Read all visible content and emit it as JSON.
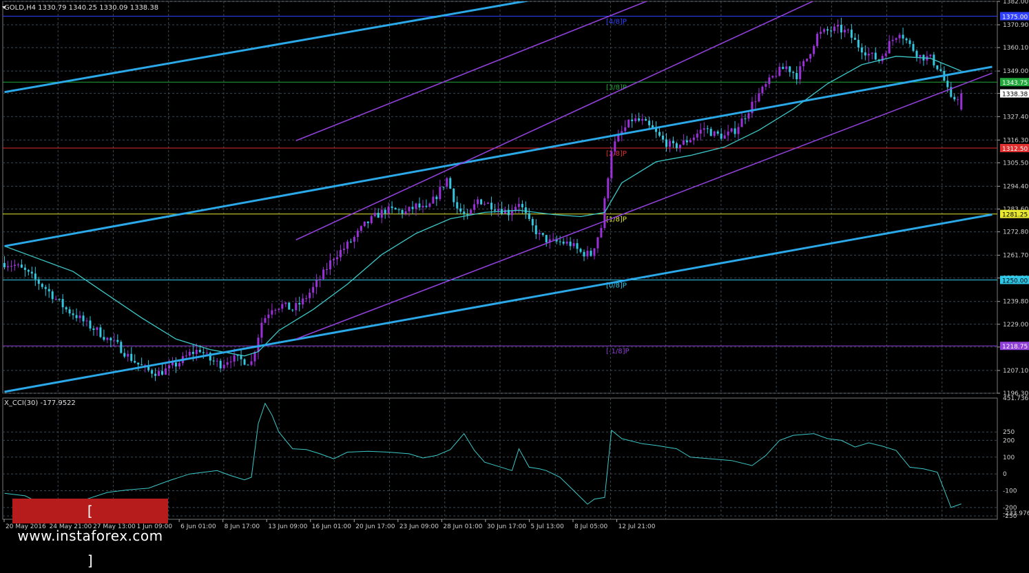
{
  "header": {
    "main_title": "GOLD,H4  1330.79 1340.25 1330.09 1338.38",
    "sub_title": "X_CCI(30) -177.9522"
  },
  "colors": {
    "background": "#000000",
    "grid": "#3a4a56",
    "candle_bull": "#9b30d9",
    "candle_bear": "#33c7e0",
    "moving_average": "#3cc8c8",
    "channel_blue": "#2aa8e8",
    "channel_purple": "#9040d8",
    "cci_line": "#3cc8c8",
    "axis_text": "#cfcfcf"
  },
  "watermark": {
    "text": "[ www.instaforex.com ]"
  },
  "chart_data": [
    {
      "type": "candlestick",
      "symbol": "GOLD",
      "timeframe": "H4",
      "ohlc_last": {
        "open": 1330.79,
        "high": 1340.25,
        "low": 1330.09,
        "close": 1338.38
      },
      "x_tick_labels": [
        "20 May 2016",
        "24 May 21:00",
        "27 May 13:00",
        "1 Jun 09:00",
        "6 Jun 01:00",
        "8 Jun 17:00",
        "13 Jun 09:00",
        "16 Jun 01:00",
        "20 Jun 17:00",
        "23 Jun 09:00",
        "28 Jun 01:00",
        "30 Jun 17:00",
        "5 Jul 13:00",
        "8 Jul 05:00",
        "12 Jul 21:00"
      ],
      "y_ticks": [
        1382.0,
        1370.9,
        1360.1,
        1349.0,
        1338.38,
        1327.4,
        1316.3,
        1305.5,
        1294.4,
        1283.6,
        1272.8,
        1261.7,
        1250.9,
        1239.8,
        1229.0,
        1218.2,
        1207.1,
        1196.3
      ],
      "ylim": [
        1196.3,
        1382.0
      ],
      "close_path": [
        [
          0,
          1258
        ],
        [
          3,
          1257
        ],
        [
          6,
          1254
        ],
        [
          9,
          1250
        ],
        [
          12,
          1246
        ],
        [
          15,
          1241
        ],
        [
          18,
          1236
        ],
        [
          21,
          1233
        ],
        [
          24,
          1229
        ],
        [
          27,
          1226
        ],
        [
          30,
          1222
        ],
        [
          33,
          1219
        ],
        [
          36,
          1214
        ],
        [
          39,
          1210
        ],
        [
          42,
          1207
        ],
        [
          45,
          1206
        ],
        [
          48,
          1208
        ],
        [
          51,
          1211
        ],
        [
          54,
          1215
        ],
        [
          57,
          1217
        ],
        [
          60,
          1212
        ],
        [
          63,
          1210
        ],
        [
          66,
          1213
        ],
        [
          69,
          1212
        ],
        [
          72,
          1211
        ],
        [
          75,
          1230
        ],
        [
          78,
          1237
        ],
        [
          81,
          1238
        ],
        [
          84,
          1236
        ],
        [
          87,
          1240
        ],
        [
          90,
          1246
        ],
        [
          93,
          1253
        ],
        [
          96,
          1261
        ],
        [
          99,
          1265
        ],
        [
          102,
          1270
        ],
        [
          105,
          1276
        ],
        [
          108,
          1280
        ],
        [
          111,
          1283
        ],
        [
          114,
          1283
        ],
        [
          117,
          1282
        ],
        [
          120,
          1285
        ],
        [
          123,
          1283
        ],
        [
          126,
          1290
        ],
        [
          129,
          1298
        ],
        [
          132,
          1284
        ],
        [
          135,
          1279
        ],
        [
          138,
          1288
        ],
        [
          141,
          1286
        ],
        [
          144,
          1284
        ],
        [
          147,
          1282
        ],
        [
          150,
          1287
        ],
        [
          153,
          1277
        ],
        [
          156,
          1271
        ],
        [
          159,
          1268
        ],
        [
          162,
          1268
        ],
        [
          165,
          1267
        ],
        [
          168,
          1263
        ],
        [
          171,
          1262
        ],
        [
          174,
          1275
        ],
        [
          177,
          1312
        ],
        [
          180,
          1320
        ],
        [
          183,
          1326
        ],
        [
          186,
          1325
        ],
        [
          189,
          1321
        ],
        [
          192,
          1316
        ],
        [
          195,
          1313
        ],
        [
          198,
          1315
        ],
        [
          201,
          1318
        ],
        [
          204,
          1322
        ],
        [
          207,
          1319
        ],
        [
          210,
          1318
        ],
        [
          213,
          1321
        ],
        [
          216,
          1328
        ],
        [
          219,
          1336
        ],
        [
          222,
          1342
        ],
        [
          225,
          1348
        ],
        [
          228,
          1351
        ],
        [
          231,
          1347
        ],
        [
          234,
          1355
        ],
        [
          237,
          1366
        ],
        [
          240,
          1368
        ],
        [
          243,
          1369
        ],
        [
          246,
          1367
        ],
        [
          249,
          1361
        ],
        [
          252,
          1357
        ],
        [
          255,
          1354
        ],
        [
          258,
          1362
        ],
        [
          261,
          1368
        ],
        [
          264,
          1361
        ],
        [
          267,
          1356
        ],
        [
          270,
          1355
        ],
        [
          273,
          1349
        ],
        [
          276,
          1335
        ],
        [
          279,
          1338
        ]
      ],
      "moving_average_path": [
        [
          0,
          1266
        ],
        [
          10,
          1260
        ],
        [
          20,
          1254
        ],
        [
          30,
          1243
        ],
        [
          40,
          1232
        ],
        [
          50,
          1222
        ],
        [
          60,
          1217
        ],
        [
          70,
          1214
        ],
        [
          74,
          1216
        ],
        [
          80,
          1226
        ],
        [
          90,
          1236
        ],
        [
          100,
          1248
        ],
        [
          110,
          1262
        ],
        [
          120,
          1272
        ],
        [
          130,
          1279
        ],
        [
          140,
          1282
        ],
        [
          150,
          1283
        ],
        [
          160,
          1281
        ],
        [
          168,
          1280
        ],
        [
          175,
          1282
        ],
        [
          180,
          1296
        ],
        [
          190,
          1306
        ],
        [
          200,
          1309
        ],
        [
          210,
          1313
        ],
        [
          220,
          1321
        ],
        [
          230,
          1331
        ],
        [
          240,
          1343
        ],
        [
          250,
          1352
        ],
        [
          260,
          1356
        ],
        [
          270,
          1355
        ],
        [
          279,
          1349
        ]
      ],
      "murrey_levels": [
        {
          "label": "[4/8]P",
          "price": 1375.0,
          "color": "#3040ff"
        },
        {
          "label": "[3/8]P",
          "price": 1343.75,
          "color": "#22a83c"
        },
        {
          "label": "[2/8]P",
          "price": 1312.5,
          "color": "#e03030"
        },
        {
          "label": "[1/8]P",
          "price": 1281.25,
          "color": "#e8e830"
        },
        {
          "label": "[0/8]P",
          "price": 1250.0,
          "color": "#30c8e8"
        },
        {
          "label": "[-1/8]P",
          "price": 1218.75,
          "color": "#9040d8"
        }
      ],
      "price_tags": [
        {
          "price": 1375.0,
          "label": "1375.00",
          "color": "#3040ff"
        },
        {
          "price": 1343.75,
          "label": "1343.75",
          "color": "#22a83c"
        },
        {
          "price": 1338.38,
          "label": "1338.38",
          "color": "#000000"
        },
        {
          "price": 1312.5,
          "label": "1312.50",
          "color": "#e03030"
        },
        {
          "price": 1281.25,
          "label": "1281.25",
          "color": "#e8e830"
        },
        {
          "price": 1250.0,
          "label": "1250.00",
          "color": "#30c8e8"
        },
        {
          "price": 1218.75,
          "label": "1218.75",
          "color": "#9040d8"
        }
      ],
      "trend_lines": [
        {
          "name": "blue-channel-upper",
          "color": "#2aa8e8",
          "p1": [
            0,
            1339
          ],
          "p2": [
            155,
            1383
          ]
        },
        {
          "name": "blue-channel-middle",
          "color": "#2aa8e8",
          "p1": [
            0,
            1266
          ],
          "p2": [
            288,
            1351
          ]
        },
        {
          "name": "blue-channel-lower",
          "color": "#2aa8e8",
          "p1": [
            0,
            1197
          ],
          "p2": [
            288,
            1281
          ]
        },
        {
          "name": "purple-channel-upper",
          "color": "#9040d8",
          "p1": [
            85,
            1316
          ],
          "p2": [
            198,
            1389
          ]
        },
        {
          "name": "purple-channel-middle",
          "color": "#9040d8",
          "p1": [
            85,
            1269
          ],
          "p2": [
            245,
            1389
          ]
        },
        {
          "name": "purple-channel-lower",
          "color": "#9040d8",
          "p1": [
            85,
            1222
          ],
          "p2": [
            288,
            1348
          ]
        }
      ]
    },
    {
      "type": "line",
      "indicator": "X_CCI(30)",
      "last_value": -177.9522,
      "y_ticks": [
        451.7367,
        250,
        200,
        100,
        0.0,
        -100,
        -200,
        -250,
        -233.9762
      ],
      "ylim": [
        -270,
        451.7367
      ],
      "values_path": [
        [
          0,
          -115
        ],
        [
          6,
          -130
        ],
        [
          12,
          -190
        ],
        [
          18,
          -205
        ],
        [
          24,
          -150
        ],
        [
          30,
          -110
        ],
        [
          36,
          -95
        ],
        [
          42,
          -85
        ],
        [
          48,
          -40
        ],
        [
          54,
          0
        ],
        [
          58,
          10
        ],
        [
          62,
          20
        ],
        [
          66,
          -10
        ],
        [
          70,
          -35
        ],
        [
          72,
          -20
        ],
        [
          74,
          300
        ],
        [
          76,
          420
        ],
        [
          78,
          350
        ],
        [
          80,
          250
        ],
        [
          84,
          150
        ],
        [
          88,
          145
        ],
        [
          92,
          120
        ],
        [
          96,
          90
        ],
        [
          100,
          130
        ],
        [
          106,
          135
        ],
        [
          112,
          130
        ],
        [
          118,
          120
        ],
        [
          122,
          95
        ],
        [
          126,
          110
        ],
        [
          130,
          145
        ],
        [
          134,
          240
        ],
        [
          137,
          140
        ],
        [
          140,
          70
        ],
        [
          144,
          45
        ],
        [
          148,
          20
        ],
        [
          150,
          150
        ],
        [
          153,
          40
        ],
        [
          156,
          30
        ],
        [
          158,
          20
        ],
        [
          162,
          -20
        ],
        [
          166,
          -100
        ],
        [
          170,
          -180
        ],
        [
          172,
          -150
        ],
        [
          175,
          -140
        ],
        [
          177,
          260
        ],
        [
          180,
          210
        ],
        [
          186,
          180
        ],
        [
          190,
          170
        ],
        [
          196,
          150
        ],
        [
          200,
          100
        ],
        [
          206,
          90
        ],
        [
          212,
          80
        ],
        [
          218,
          50
        ],
        [
          222,
          110
        ],
        [
          226,
          200
        ],
        [
          230,
          230
        ],
        [
          236,
          240
        ],
        [
          240,
          210
        ],
        [
          244,
          200
        ],
        [
          248,
          160
        ],
        [
          252,
          185
        ],
        [
          256,
          165
        ],
        [
          260,
          140
        ],
        [
          264,
          40
        ],
        [
          268,
          30
        ],
        [
          272,
          10
        ],
        [
          276,
          -200
        ],
        [
          279,
          -178
        ]
      ]
    }
  ]
}
